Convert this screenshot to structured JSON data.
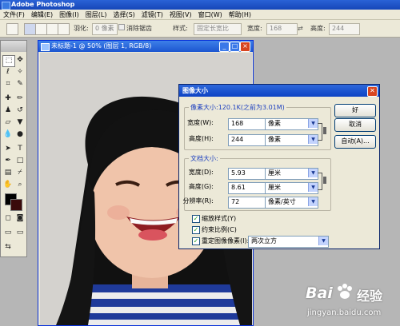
{
  "app": {
    "title": "Adobe Photoshop"
  },
  "menu": [
    "文件(F)",
    "编辑(E)",
    "图像(I)",
    "图层(L)",
    "选择(S)",
    "滤镜(T)",
    "视图(V)",
    "窗口(W)",
    "帮助(H)"
  ],
  "options": {
    "feather_label": "羽化:",
    "feather_value": "0 像素",
    "antialias_label": "消除锯齿",
    "style_label": "样式:",
    "style_value": "固定长宽比",
    "width_label": "宽度:",
    "width_value": "168",
    "height_label": "高度:",
    "height_value": "244"
  },
  "document": {
    "title": "未标题-1 @ 50% (图层 1, RGB/8)"
  },
  "dialog": {
    "title": "图像大小",
    "pixel_dims": {
      "label": "像素大小:120.1K(之前为3.01M)",
      "width_label": "宽度(W):",
      "width_value": "168",
      "width_unit": "像素",
      "height_label": "高度(H):",
      "height_value": "244",
      "height_unit": "像素"
    },
    "doc_size": {
      "label": "文档大小:",
      "width_label": "宽度(D):",
      "width_value": "5.93",
      "width_unit": "厘米",
      "height_label": "高度(G):",
      "height_value": "8.61",
      "height_unit": "厘米",
      "res_label": "分辨率(R):",
      "res_value": "72",
      "res_unit": "像素/英寸"
    },
    "checkboxes": {
      "scale_styles": "缩放样式(Y)",
      "constrain": "约束比例(C)",
      "resample": "重定图像像素(I):"
    },
    "resample_method": "两次立方",
    "buttons": {
      "ok": "好",
      "cancel": "取消",
      "auto": "自动(A)..."
    }
  },
  "watermark": {
    "brand": "Bai",
    "brand_cn": "经验",
    "url": "jingyan.baidu.com"
  }
}
